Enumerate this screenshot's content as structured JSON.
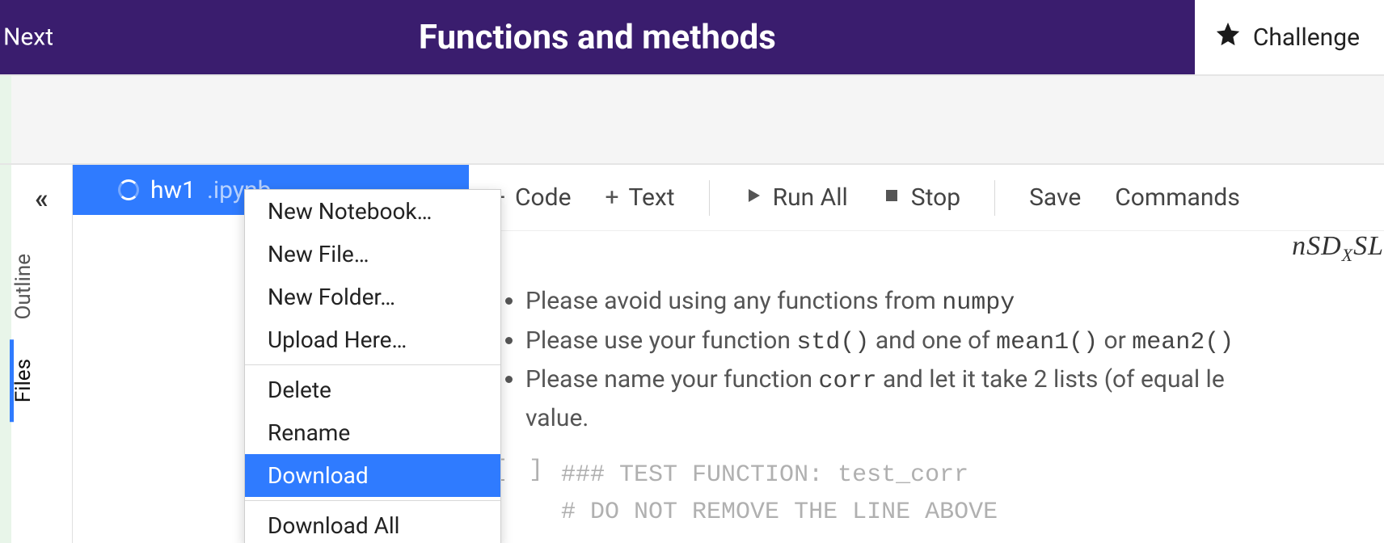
{
  "header": {
    "next_label": "Next",
    "title": "Functions and methods",
    "challenge_label": "Challenge"
  },
  "rail": {
    "tabs": [
      {
        "label": "Outline",
        "active": false
      },
      {
        "label": "Files",
        "active": true
      }
    ]
  },
  "file_tab": {
    "name": "hw1",
    "ext": ".ipynb"
  },
  "context_menu": {
    "groups": [
      [
        "New Notebook…",
        "New File…",
        "New Folder…",
        "Upload Here…"
      ],
      [
        "Delete",
        "Rename",
        "Download"
      ],
      [
        "Download All"
      ]
    ],
    "highlighted": "Download"
  },
  "toolbar": {
    "code_label": "Code",
    "text_label": "Text",
    "run_all_label": "Run All",
    "stop_label": "Stop",
    "save_label": "Save",
    "commands_label": "Commands"
  },
  "content": {
    "math_fragment": "nSD<sub>X</sub>SL",
    "bullets": [
      "Please avoid using any functions from <code>numpy</code>",
      "Please use your function <code>std()</code> and one of <code>mean1()</code> or <code>mean2()</code>",
      "Please name your function <code>corr</code> and let it take 2 lists (of equal le"
    ],
    "trailing_text": "value."
  },
  "codecell": {
    "prompt": "[ ]",
    "lines": [
      "### TEST FUNCTION: test_corr",
      "# DO NOT REMOVE THE LINE ABOVE"
    ]
  }
}
